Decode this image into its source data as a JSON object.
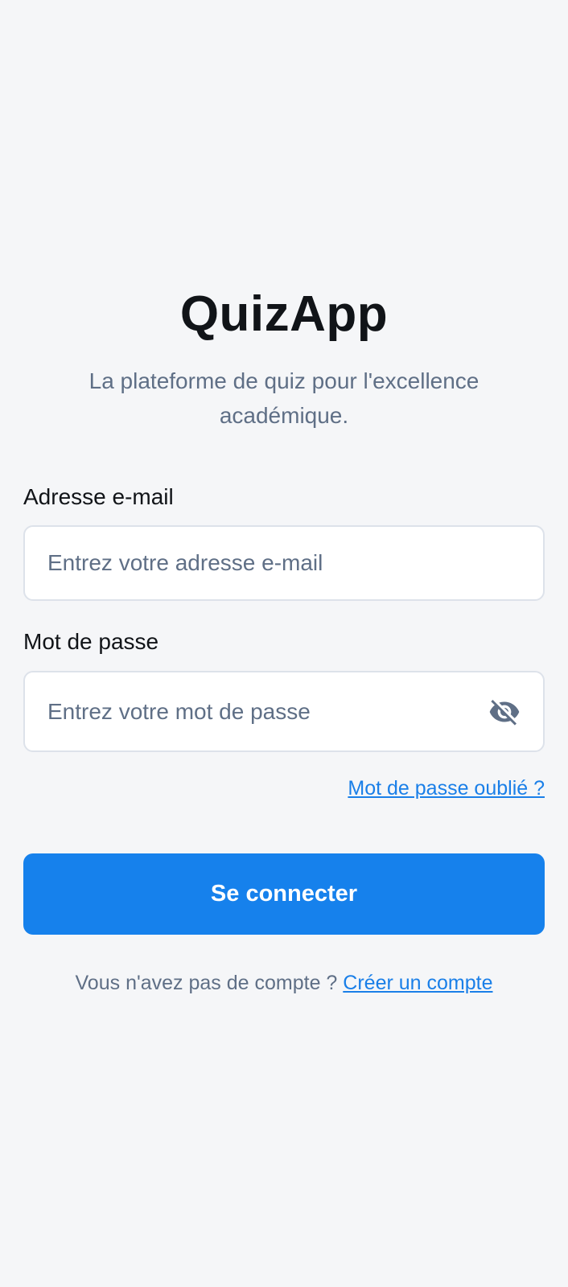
{
  "app": {
    "title": "QuizApp",
    "subtitle": "La plateforme de quiz pour l'excellence académique."
  },
  "form": {
    "email_label": "Adresse e-mail",
    "email_placeholder": "Entrez votre adresse e-mail",
    "email_value": "",
    "password_label": "Mot de passe",
    "password_placeholder": "Entrez votre mot de passe",
    "password_value": "",
    "password_toggle_icon": "eye-off-icon",
    "forgot_password_link": "Mot de passe oublié ?",
    "submit_label": "Se connecter"
  },
  "footer": {
    "no_account_text": "Vous n'avez pas de compte ?",
    "create_account_link": "Créer un compte"
  },
  "colors": {
    "background": "#f5f6f8",
    "primary": "#1681ec",
    "link": "#1a7fe8",
    "muted_text": "#5f6f86",
    "heading_text": "#111418",
    "input_border": "#dde2ea"
  }
}
